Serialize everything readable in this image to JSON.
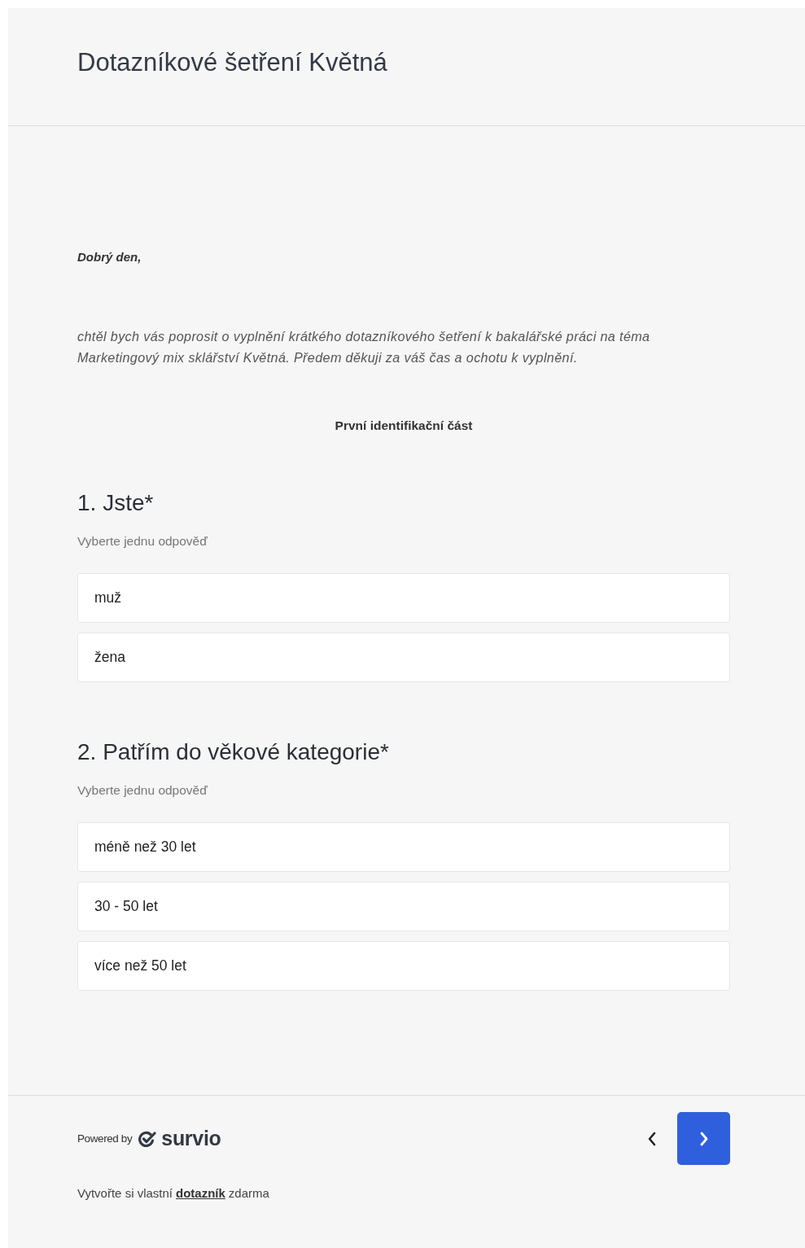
{
  "header": {
    "title": "Dotazníkové šetření Květná"
  },
  "intro": {
    "greeting": "Dobrý den,",
    "paragraph": "chtěl bych vás poprosit o vyplnění krátkého dotazníkového šetření k bakalářské práci na téma Marketingový mix sklářství Květná. Předem děkuji za váš čas a ochotu k vyplnění.",
    "section_title": "První identifikační část"
  },
  "questions": [
    {
      "title": "1. Jste*",
      "hint": "Vyberte jednu odpověď",
      "options": [
        {
          "label": "muž",
          "selected": false
        },
        {
          "label": "žena",
          "selected": false
        }
      ]
    },
    {
      "title": "2. Patřím do věkové kategorie*",
      "hint": "Vyberte jednu odpověď",
      "options": [
        {
          "label": "méně než 30 let",
          "selected": false
        },
        {
          "label": "30 - 50 let",
          "selected": false
        },
        {
          "label": "více než 50 let",
          "selected": false
        }
      ]
    }
  ],
  "footer": {
    "powered_by": "Powered by",
    "brand": "survio",
    "create_prefix": "Vytvořte si vlastní",
    "create_link": "dotazník",
    "create_suffix": "zdarma"
  }
}
